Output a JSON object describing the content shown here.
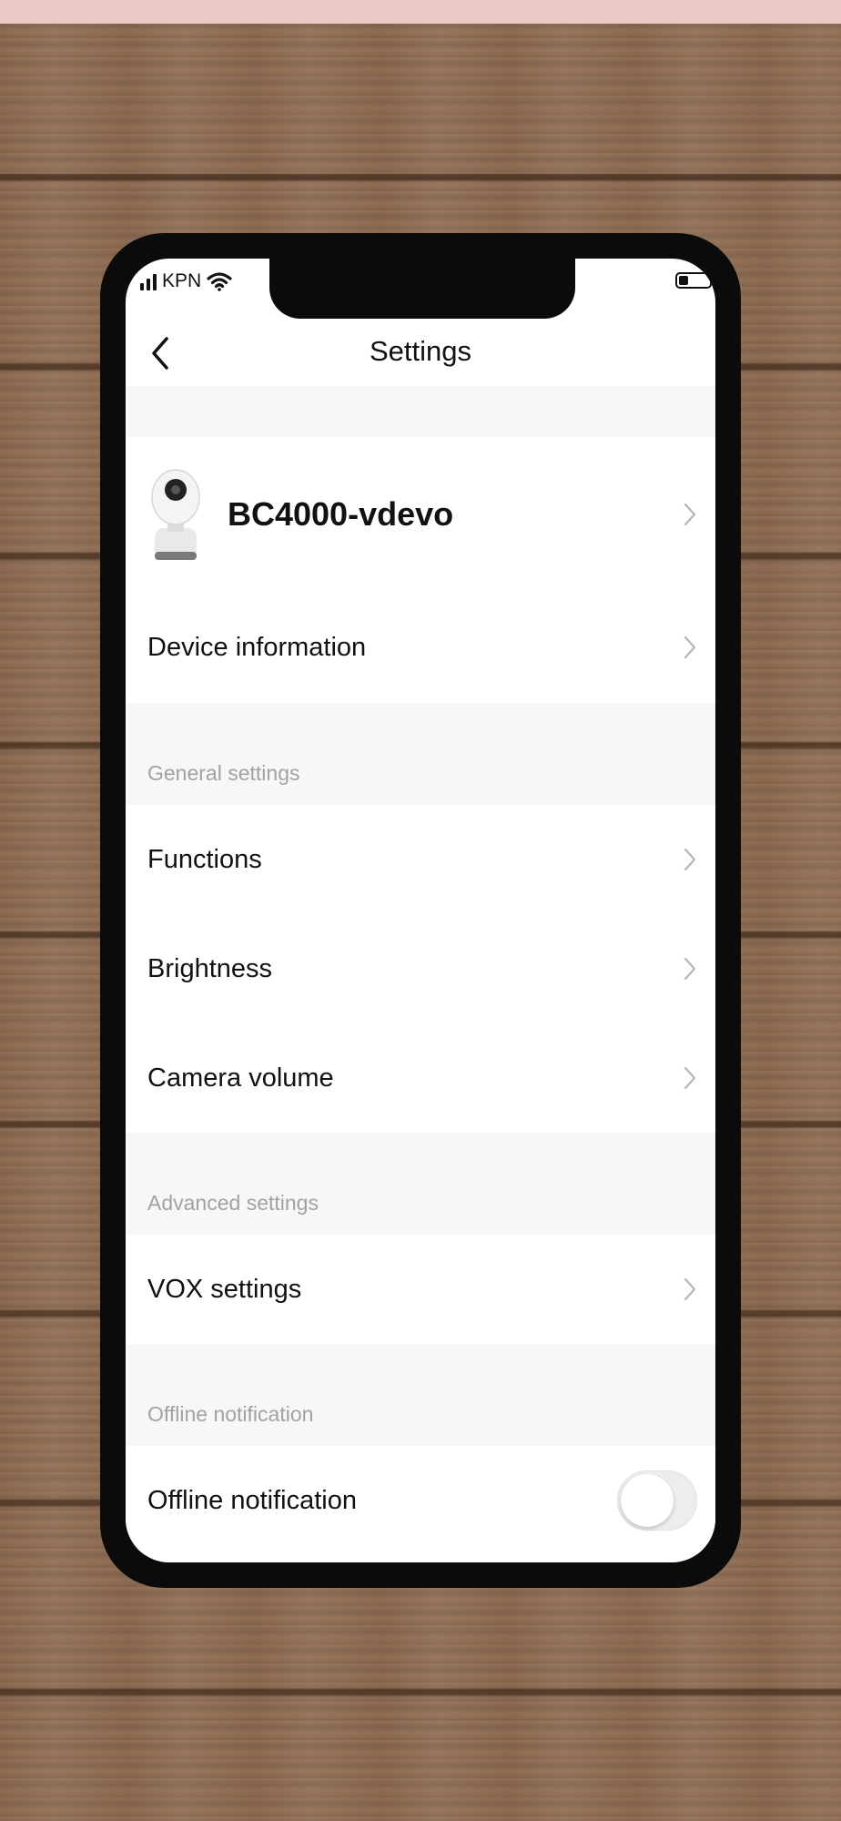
{
  "status_bar": {
    "carrier": "KPN"
  },
  "nav": {
    "title": "Settings"
  },
  "device": {
    "name": "BC4000-vdevo"
  },
  "rows": {
    "device_information": "Device information",
    "functions": "Functions",
    "brightness": "Brightness",
    "camera_volume": "Camera volume",
    "vox_settings": "VOX settings",
    "offline_notification": "Offline notification"
  },
  "sections": {
    "general": "General settings",
    "advanced": "Advanced settings",
    "offline": "Offline notification"
  },
  "toggles": {
    "offline_notification_enabled": false
  },
  "colors": {
    "background_band": "#e8c9c3",
    "section_header": "#a2a2a2",
    "phone_frame": "#0b0b0b"
  }
}
